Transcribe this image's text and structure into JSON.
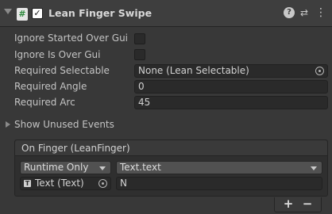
{
  "component": {
    "title": "Lean Finger Swipe",
    "enabled": true,
    "icons": {
      "script": "script-icon",
      "help": "help-icon",
      "presets": "presets-icon",
      "menu": "menu-icon"
    }
  },
  "properties": {
    "ignore_started_over_gui": {
      "label": "Ignore Started Over Gui",
      "checked": false
    },
    "ignore_is_over_gui": {
      "label": "Ignore Is Over Gui",
      "checked": false
    },
    "required_selectable": {
      "label": "Required Selectable",
      "value": "None (Lean Selectable)"
    },
    "required_angle": {
      "label": "Required Angle",
      "value": "0"
    },
    "required_arc": {
      "label": "Required Arc",
      "value": "45"
    }
  },
  "show_unused_events": {
    "label": "Show Unused Events",
    "expanded": false
  },
  "on_finger_event": {
    "title": "On Finger (LeanFinger)",
    "runtime_mode": "Runtime Only",
    "function": "Text.text",
    "target_object": "Text (Text)",
    "argument_value": "N",
    "add_label": "+",
    "remove_label": "−"
  }
}
